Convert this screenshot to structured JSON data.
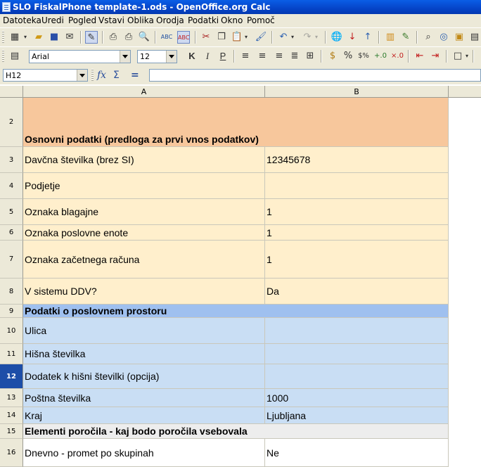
{
  "window": {
    "title": "SLO FiskalPhone template-1.ods - OpenOffice.org Calc"
  },
  "menu": [
    "Datoteka",
    "Uredi",
    "Pogled",
    "Vstavi",
    "Oblika",
    "Orodja",
    "Podatki",
    "Okno",
    "Pomoč"
  ],
  "format_bar": {
    "font_name": "Arial",
    "font_size": "12",
    "bold": "K",
    "italic": "I",
    "underline": "P"
  },
  "formula_bar": {
    "cell_ref": "H12",
    "fx": "fx",
    "sigma": "Σ",
    "equals": "=",
    "content": ""
  },
  "columns": [
    "A",
    "B"
  ],
  "rows": [
    {
      "num": "2",
      "a": "Osnovni podatki (predloga za prvi vnos podatkov)",
      "b": ""
    },
    {
      "num": "3",
      "a": "Davčna številka (brez SI)",
      "b": "12345678"
    },
    {
      "num": "4",
      "a": "Podjetje",
      "b": ""
    },
    {
      "num": "5",
      "a": "Oznaka blagajne",
      "b": "1"
    },
    {
      "num": "6",
      "a": "Oznaka poslovne enote",
      "b": "1"
    },
    {
      "num": "7",
      "a": "Oznaka začetnega računa",
      "b": "1"
    },
    {
      "num": "8",
      "a": "V sistemu DDV?",
      "b": "Da"
    },
    {
      "num": "9",
      "a": "Podatki o poslovnem prostoru",
      "b": ""
    },
    {
      "num": "10",
      "a": "Ulica",
      "b": ""
    },
    {
      "num": "11",
      "a": "Hišna številka",
      "b": ""
    },
    {
      "num": "12",
      "a": "Dodatek k hišni številki (opcija)",
      "b": ""
    },
    {
      "num": "13",
      "a": "Poštna številka",
      "b": "1000"
    },
    {
      "num": "14",
      "a": "Kraj",
      "b": "Ljubljana"
    },
    {
      "num": "15",
      "a": "Elementi poročila - kaj bodo poročila vsebovala",
      "b": ""
    },
    {
      "num": "16",
      "a": "Dnevno - promet po skupinah",
      "b": "Ne"
    }
  ],
  "colors": {
    "section_header_orange": "#f7c79c",
    "input_cream": "#ffefcc",
    "section_header_blue": "#9fc0ef",
    "input_lightblue": "#c9def4",
    "section_header_gray": "#ededed",
    "selected_row": "#1d4ea8"
  },
  "selected_row": "12"
}
